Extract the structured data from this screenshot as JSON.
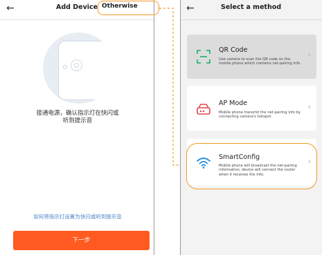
{
  "left": {
    "back_glyph": "←",
    "title": "Add Device",
    "otherwise": "Otherwise",
    "instruction_line1": "接通电源，确认指示灯在快闪或",
    "instruction_line2": "听到提示音",
    "help_link": "如何将指示灯设置为快闪或听到提示音",
    "next_button": "下一步"
  },
  "right": {
    "back_glyph": "←",
    "title": "Select a method",
    "methods": [
      {
        "title": "QR Code",
        "description": "Use camera to scan the QR code on the mobile phone which contains net-pairing info.",
        "icon": "qr-scan-icon"
      },
      {
        "title": "AP Mode",
        "description": "Mobile phone transmit the net-pairing info by connecting camera's hotspot.",
        "icon": "router-icon"
      },
      {
        "title": "SmartConfig",
        "description": "Mobile phone will broadcast the net-pairing information, device will connect the router when it receives the info.",
        "icon": "wifi-icon"
      }
    ],
    "chevron": "›"
  },
  "colors": {
    "accent_orange": "#f29a24",
    "button_orange": "#ff5a1f",
    "link_blue": "#4a86c9",
    "qr_green": "#2bb673",
    "ap_red": "#e0464e",
    "wifi_blue": "#1f8fe0",
    "selected_card": "#dcdcdc"
  }
}
